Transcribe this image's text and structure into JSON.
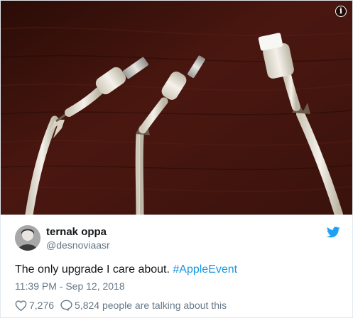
{
  "tweet": {
    "display_name": "ternak oppa",
    "handle": "@desnoviaasr",
    "text_plain": "The only upgrade I care about. ",
    "hashtag": "#AppleEvent",
    "timestamp": "11:39 PM - Sep 12, 2018",
    "likes": "7,276",
    "talking": "5,824 people are talking about this"
  },
  "icons": {
    "info": "info-icon",
    "twitter": "twitter-bird-icon",
    "like": "heart-icon",
    "reply": "speech-bubble-icon"
  },
  "colors": {
    "link": "#1b95e0",
    "secondary_text": "#657786",
    "twitter_blue": "#1da1f2",
    "border": "#e1e8ed"
  }
}
